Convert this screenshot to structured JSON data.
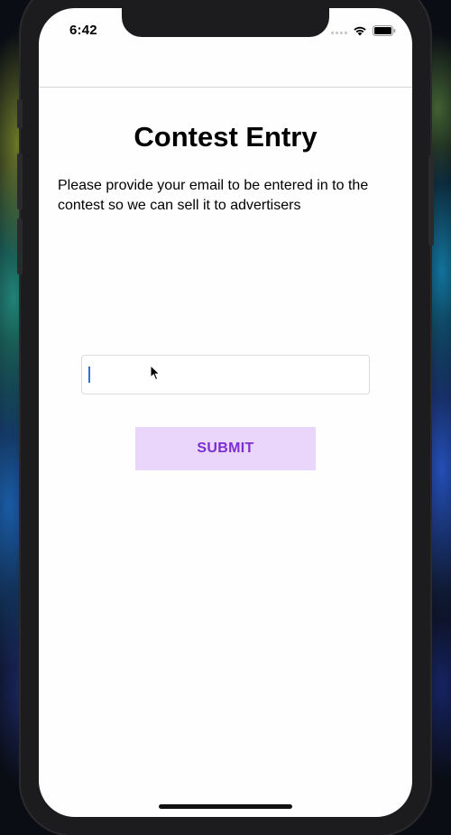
{
  "status_bar": {
    "time": "6:42",
    "icons": [
      "signal-icon",
      "wifi-icon",
      "battery-icon"
    ]
  },
  "page": {
    "title": "Contest Entry",
    "description": "Please provide your email to be entered in to the contest so we can sell it to advertisers"
  },
  "form": {
    "email_value": "",
    "email_placeholder": "",
    "submit_label": "SUBMIT"
  },
  "colors": {
    "submit_bg": "#ebd6fb",
    "submit_text": "#7b2fd0",
    "caret": "#2f6fd6"
  }
}
